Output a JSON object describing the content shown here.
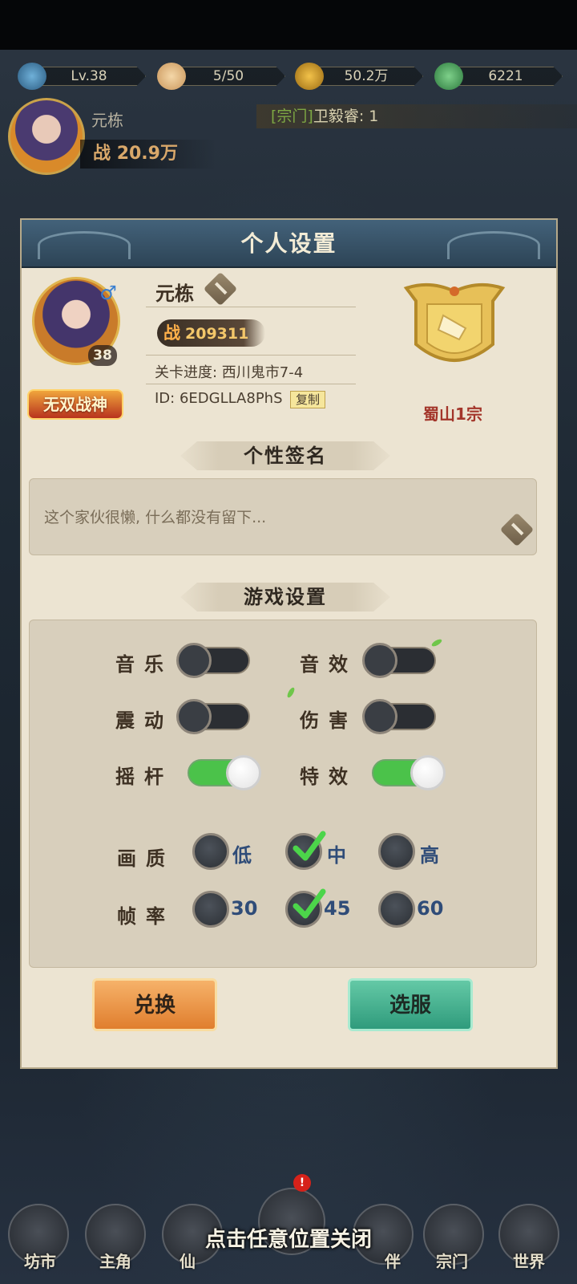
{
  "resources": {
    "level": "Lv.38",
    "stamina": "5/50",
    "coins": "50.2万",
    "jade": "6221"
  },
  "header": {
    "player_name": "元栋",
    "power_label": "战",
    "power_value": "20.9万",
    "chat_tag": "[宗门]",
    "chat_text": "卫毅睿: 1"
  },
  "dialog": {
    "title": "个人设置",
    "profile": {
      "name": "元栋",
      "level": "38",
      "title_badge": "无双战神",
      "power_label": "战",
      "power": "209311",
      "stage": "关卡进度: 西川鬼市7-4",
      "uid": "ID: 6EDGLLA8PhS",
      "copy_label": "复制",
      "sect_name": "蜀山1宗"
    },
    "signature": {
      "title": "个性签名",
      "text": "这个家伙很懒, 什么都没有留下..."
    },
    "game_settings": {
      "title": "游戏设置",
      "toggles": [
        {
          "label": "音乐",
          "on": false
        },
        {
          "label": "音效",
          "on": false
        },
        {
          "label": "震动",
          "on": false
        },
        {
          "label": "伤害",
          "on": false
        },
        {
          "label": "摇杆",
          "on": true
        },
        {
          "label": "特效",
          "on": true
        }
      ],
      "quality": {
        "label": "画质",
        "options": [
          "低",
          "中",
          "高"
        ],
        "selected": "中"
      },
      "fps": {
        "label": "帧率",
        "options": [
          "30",
          "45",
          "60"
        ],
        "selected": "45"
      }
    },
    "buttons": {
      "redeem": "兑换",
      "server": "选服"
    }
  },
  "close_hint": "点击任意位置关闭",
  "bottom_nav": {
    "items": [
      "坊市",
      "主角",
      "仙",
      "",
      "伴",
      "宗门",
      "世界"
    ],
    "badge": "!"
  },
  "colors": {
    "toggle_on": "#4bc24a",
    "sect_name": "#a3352a",
    "option_text": "#2f4c78"
  }
}
